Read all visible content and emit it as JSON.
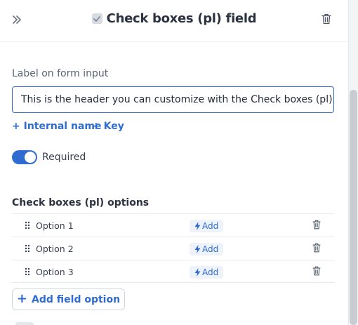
{
  "header": {
    "title": "Check boxes (pl) field",
    "collapse_icon": "chevrons-right-icon",
    "delete_icon": "trash-icon"
  },
  "form": {
    "label": "Label on form input",
    "input_value": "This is the header you can customize with the Check boxes (pl)",
    "internal_name_link": "+ Internal name",
    "key_link": "+ Key",
    "required_label": "Required",
    "required_on": true
  },
  "options_section": {
    "title": "Check boxes (pl) options",
    "items": [
      {
        "label": "Option 1",
        "add_label": "Add"
      },
      {
        "label": "Option 2",
        "add_label": "Add"
      },
      {
        "label": "Option 3",
        "add_label": "Add"
      }
    ],
    "add_field_option": "Add field option"
  },
  "colors": {
    "accent": "#2f6bd0",
    "pill_bg": "#eef3fb"
  }
}
